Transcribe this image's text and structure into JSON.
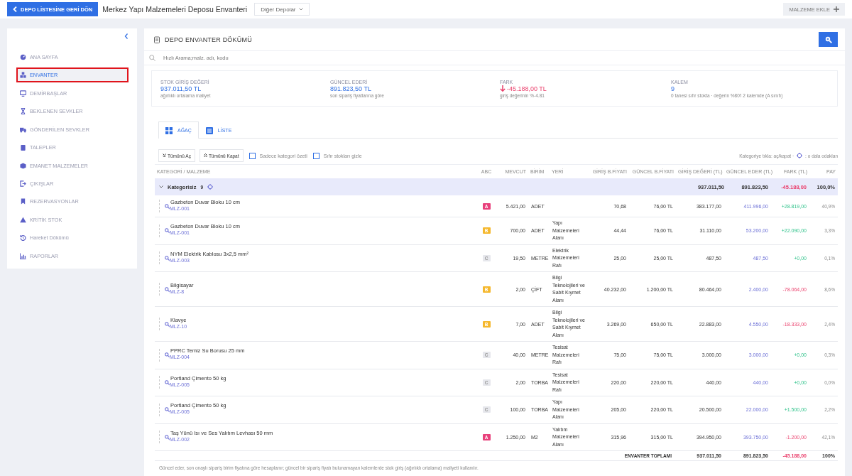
{
  "topbar": {
    "back_button": "DEPO LİSTESİNE GERİ DÖN",
    "title": "Merkez Yapı Malzemeleri Deposu Envanteri",
    "dropdown": "Diğer Depolar",
    "add_button": "MALZEME EKLE"
  },
  "sidebar": {
    "items": [
      {
        "label": "ANA SAYFA",
        "selected": false,
        "flagged": false
      },
      {
        "label": "ENVANTER",
        "selected": true,
        "flagged": true
      },
      {
        "label": "DEMİRBAŞLAR",
        "selected": false,
        "flagged": false
      },
      {
        "label": "BEKLENEN SEVKLER",
        "selected": false,
        "flagged": false
      },
      {
        "label": "GÖNDERİLEN SEVKLER",
        "selected": false,
        "flagged": false
      },
      {
        "label": "TALEPLER",
        "selected": false,
        "flagged": false
      },
      {
        "label": "EMANET MALZEMELER",
        "selected": false,
        "flagged": false
      },
      {
        "label": "ÇIKIŞLAR",
        "selected": false,
        "flagged": false
      },
      {
        "label": "REZERVASYONLAR",
        "selected": false,
        "flagged": false
      },
      {
        "label": "KRİTİK STOK",
        "selected": false,
        "flagged": false
      },
      {
        "label": "Hareket Dökümü",
        "selected": false,
        "flagged": false
      },
      {
        "label": "RAPORLAR",
        "selected": false,
        "flagged": false
      }
    ]
  },
  "panel": {
    "title": "DEPO ENVANTER DÖKÜMÜ",
    "search": {
      "placeholder": "Hızlı Arama;malz. adı, kodu"
    }
  },
  "stats": [
    {
      "label": "STOK GİRİŞ DEĞERİ",
      "value": "937.011,50 TL",
      "note": "ağırlıklı ortalama maliyet",
      "kind": "amount"
    },
    {
      "label": "GÜNCEL EDERİ",
      "value": "891.823,50 TL",
      "note": "son sipariş fiyatlarına göre",
      "kind": "amount"
    },
    {
      "label": "FARK",
      "value": "-45.188,00 TL",
      "note": "giriş değerinin %-4.81",
      "kind": "negative"
    },
    {
      "label": "KALEM",
      "value": "9",
      "note": "0 tanesi sıfır stokta · değerin %80'i 2 kalemde (A sınıfı)",
      "kind": "amount"
    }
  ],
  "tabs": [
    {
      "label": "AĞAÇ",
      "selected": true
    },
    {
      "label": "LİSTE",
      "selected": false
    }
  ],
  "toolbar": {
    "buttons": [
      "Tümünü Aç",
      "Tümünü Kapat"
    ],
    "filters": [
      {
        "label": "Sadece kategori özeti",
        "checked": false
      },
      {
        "label": "Sıfır stokları gizle",
        "checked": false
      }
    ],
    "hint_before": "Kategoriye tıkla: aç/kapat ·",
    "hint_after": ": o dala odaklan"
  },
  "table": {
    "columns": [
      "KATEGORİ / MALZEME",
      "ABC",
      "MEVCUT",
      "BİRİM",
      "YERİ",
      "GİRİŞ B.FİYATI",
      "GÜNCEL B.FİYATI",
      "GİRİŞ DEĞERİ (TL)",
      "GÜNCEL EDER (TL)",
      "FARK (TL)",
      "PAY"
    ],
    "category": {
      "name": "Kategorisiz",
      "count": "9",
      "expanded": true,
      "entry_value": "937.011,50",
      "current_value": "891.823,50",
      "difference": "-45.188,00",
      "kind": "loss",
      "share": "100,0%"
    },
    "rows": [
      {
        "name": "Gazbeton Duvar Bloku 10 cm",
        "code": "MLZ-001",
        "abc": {
          "label": "A",
          "color": "#e8407b"
        },
        "stock": "5.421,00",
        "unit": "ADET",
        "location": "",
        "entry_price": "70,68",
        "current_price": "76,00 TL",
        "entry_value": "383.177,00",
        "current_value": "411.996,00",
        "difference": "+28.819,00",
        "kind": "gain",
        "share": "40,9%"
      },
      {
        "name": "Gazbeton Duvar Bloku 10 cm",
        "code": "MLZ-001",
        "abc": {
          "label": "B",
          "color": "#f5b82e"
        },
        "stock": "700,00",
        "unit": "ADET",
        "location": "Yapı Malzemeleri Alanı",
        "entry_price": "44,44",
        "current_price": "76,00 TL",
        "entry_value": "31.110,00",
        "current_value": "53.200,00",
        "difference": "+22.090,00",
        "kind": "gain",
        "share": "3,3%"
      },
      {
        "name": "NYM Elektrik Kablosu 3x2,5 mm²",
        "code": "MLZ-003",
        "abc": {
          "label": "C",
          "color": "#e6e7ec"
        },
        "stock": "19,50",
        "unit": "METRE",
        "location": "Elektrik Malzemeleri Rafı",
        "entry_price": "25,00",
        "current_price": "25,00 TL",
        "entry_value": "487,50",
        "current_value": "487,50",
        "difference": "+0,00",
        "kind": "gain",
        "share": "0,1%"
      },
      {
        "name": "Bilgisayar",
        "code": "MLZ-8",
        "abc": {
          "label": "B",
          "color": "#f5b82e"
        },
        "stock": "2,00",
        "unit": "ÇİFT",
        "location": "Bilgi Teknolojileri ve Sabit Kıymet Alanı",
        "entry_price": "40.232,00",
        "current_price": "1.200,00 TL",
        "entry_value": "80.464,00",
        "current_value": "2.400,00",
        "difference": "-78.064,00",
        "kind": "loss",
        "share": "8,6%"
      },
      {
        "name": "Klavye",
        "code": "MLZ-10",
        "abc": {
          "label": "B",
          "color": "#f5b82e"
        },
        "stock": "7,00",
        "unit": "ADET",
        "location": "Bilgi Teknolojileri ve Sabit Kıymet Alanı",
        "entry_price": "3.269,00",
        "current_price": "650,00 TL",
        "entry_value": "22.883,00",
        "current_value": "4.550,00",
        "difference": "-18.333,00",
        "kind": "loss",
        "share": "2,4%"
      },
      {
        "name": "PPRC Temiz Su Borusu 25 mm",
        "code": "MLZ-004",
        "abc": {
          "label": "C",
          "color": "#e6e7ec"
        },
        "stock": "40,00",
        "unit": "METRE",
        "location": "Tesisat Malzemeleri Rafı",
        "entry_price": "75,00",
        "current_price": "75,00 TL",
        "entry_value": "3.000,00",
        "current_value": "3.000,00",
        "difference": "+0,00",
        "kind": "gain",
        "share": "0,3%"
      },
      {
        "name": "Portland Çimento 50 kg",
        "code": "MLZ-005",
        "abc": {
          "label": "C",
          "color": "#e6e7ec"
        },
        "stock": "2,00",
        "unit": "TORBA",
        "location": "Tesisat Malzemeleri Rafı",
        "entry_price": "220,00",
        "current_price": "220,00 TL",
        "entry_value": "440,00",
        "current_value": "440,00",
        "difference": "+0,00",
        "kind": "gain",
        "share": "0,0%"
      },
      {
        "name": "Portland Çimento 50 kg",
        "code": "MLZ-005",
        "abc": {
          "label": "C",
          "color": "#e6e7ec"
        },
        "stock": "100,00",
        "unit": "TORBA",
        "location": "Yapı Malzemeleri Alanı",
        "entry_price": "205,00",
        "current_price": "220,00 TL",
        "entry_value": "20.500,00",
        "current_value": "22.000,00",
        "difference": "+1.500,00",
        "kind": "gain",
        "share": "2,2%"
      },
      {
        "name": "Taş Yünü Isı ve Ses Yalıtım Levhası 50 mm",
        "code": "MLZ-002",
        "abc": {
          "label": "A",
          "color": "#e8407b"
        },
        "stock": "1.250,00",
        "unit": "M2",
        "location": "Yalıtım Malzemeleri Alanı",
        "entry_price": "315,96",
        "current_price": "315,00 TL",
        "entry_value": "394.950,00",
        "current_value": "393.750,00",
        "difference": "-1.200,00",
        "kind": "loss",
        "share": "42,1%"
      }
    ],
    "total": {
      "label": "ENVANTER TOPLAMI",
      "entry_value": "937.011,50",
      "current_value": "891.823,50",
      "difference": "-45.188,00",
      "kind": "loss",
      "share": "100%"
    }
  },
  "footnote": "Güncel eder, son onaylı sipariş birim fiyatına göre hesaplanır; güncel bir sipariş fiyatı bulunamayan kalemlerde stok giriş (ağırlıklı ortalama) maliyeti kullanılır."
}
